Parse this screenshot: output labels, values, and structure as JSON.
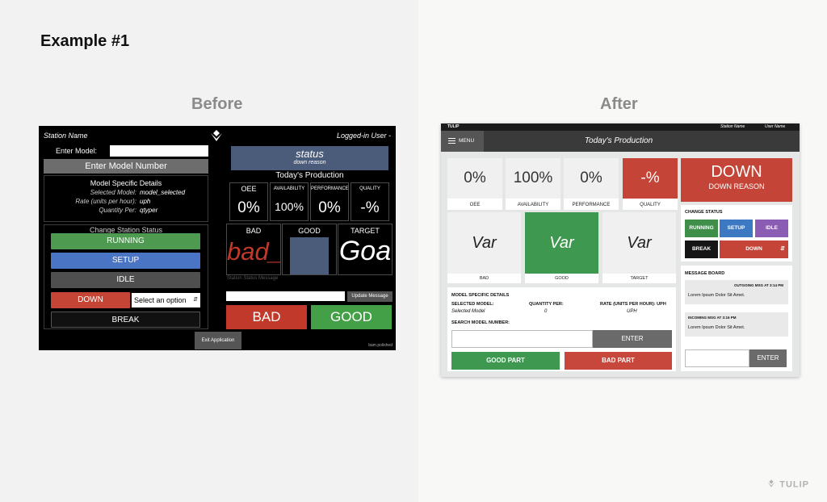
{
  "page": {
    "heading": "Example #1",
    "before_label": "Before",
    "after_label": "After",
    "brand": "TULIP"
  },
  "before": {
    "station_name": "Station Name",
    "logged_in_user": "Logged-in User -",
    "enter_model_label": "Enter Model:",
    "enter_model_button": "Enter Model Number",
    "model_details": {
      "title": "Model Specific Details",
      "rows": [
        {
          "label": "Selected Model:",
          "value": "model_selected"
        },
        {
          "label": "Rate (units per hour):",
          "value": "uph"
        },
        {
          "label": "Quantity Per:",
          "value": "qtyper"
        }
      ]
    },
    "change_status_title": "Change Station Status",
    "status_buttons": {
      "running": "RUNNING",
      "setup": "SETUP",
      "idle": "IDLE",
      "down": "DOWN",
      "break": "BREAK"
    },
    "select_option": "Select an option",
    "status": {
      "title": "status",
      "reason": "down reason"
    },
    "todays_production": "Today's Production",
    "kpis": [
      {
        "label": "OEE",
        "value": "0%"
      },
      {
        "label": "AVAILABILITY",
        "value": "100%"
      },
      {
        "label": "PERFORMANCE",
        "value": "0%"
      },
      {
        "label": "QUALITY",
        "value": "-%"
      }
    ],
    "counts": {
      "bad_label": "BAD",
      "bad_value": "bad_",
      "good_label": "GOOD",
      "target_label": "TARGET",
      "target_value": "Goa"
    },
    "station_status_message": "Station Status Message",
    "update_message_button": "Update Message",
    "bad_button": "BAD",
    "good_button": "GOOD",
    "exit_button": "Exit Application",
    "footer_user": "bam.polished",
    "colors": {
      "running": "#4e9a50",
      "setup": "#4a74c4",
      "idle": "#4f4f4f",
      "down": "#c44535",
      "break": "#111111",
      "bad": "#c0392b",
      "good": "#43a047",
      "bad_value": "#c0392b"
    }
  },
  "after": {
    "brand": "TULIP",
    "station_name": "Station Name",
    "user_name": "User Name",
    "menu_label": "MENU",
    "page_title": "Today's Production",
    "kpis": [
      {
        "label": "OEE",
        "value": "0%"
      },
      {
        "label": "AVAILABILITY",
        "value": "100%"
      },
      {
        "label": "PERFORMANCE",
        "value": "0%"
      },
      {
        "label": "QUALITY",
        "value": "-%"
      }
    ],
    "counts": [
      {
        "label": "BAD",
        "value": "Var"
      },
      {
        "label": "GOOD",
        "value": "Var"
      },
      {
        "label": "TARGET",
        "value": "Var"
      }
    ],
    "status": {
      "title": "DOWN",
      "reason": "DOWN REASON"
    },
    "change_status": {
      "title": "CHANGE STATUS",
      "running": "RUNNING",
      "setup": "SETUP",
      "idle": "IDLE",
      "break": "BREAK",
      "down": "DOWN"
    },
    "message_board": {
      "title": "MESSAGE BOARD",
      "messages": [
        {
          "header": "OUTGOING MSG",
          "time": "AT 3:14 PM",
          "text": "Lorem Ipsum Dolor Sit Amet."
        },
        {
          "header": "INCOMING MSG",
          "time": "AT 3:16 PM",
          "text": "Lorem Ipsum Dolor Sit Amet."
        }
      ],
      "enter_button": "ENTER"
    },
    "model_details": {
      "title": "MODEL SPECIFIC DETAILS",
      "selected_label": "SELECTED MODEL:",
      "selected_value": "Selected Model",
      "qty_label": "QUANTITY PER:",
      "qty_value": "0",
      "rate_label": "RATE (UNITS PER HOUR): UPH",
      "rate_value": "UPH",
      "search_label": "SEARCH MODEL NUMBER:",
      "enter_button": "ENTER",
      "good_part": "GOOD PART",
      "bad_part": "BAD PART"
    },
    "colors": {
      "header": "#3a3a3a",
      "down": "#c44437",
      "running": "#3f8e4a",
      "setup": "#3d79c2",
      "idle": "#8b5cb4",
      "break": "#161616",
      "good": "#3e9850",
      "bad": "#c8473c",
      "enter": "#6a6a6a"
    }
  }
}
